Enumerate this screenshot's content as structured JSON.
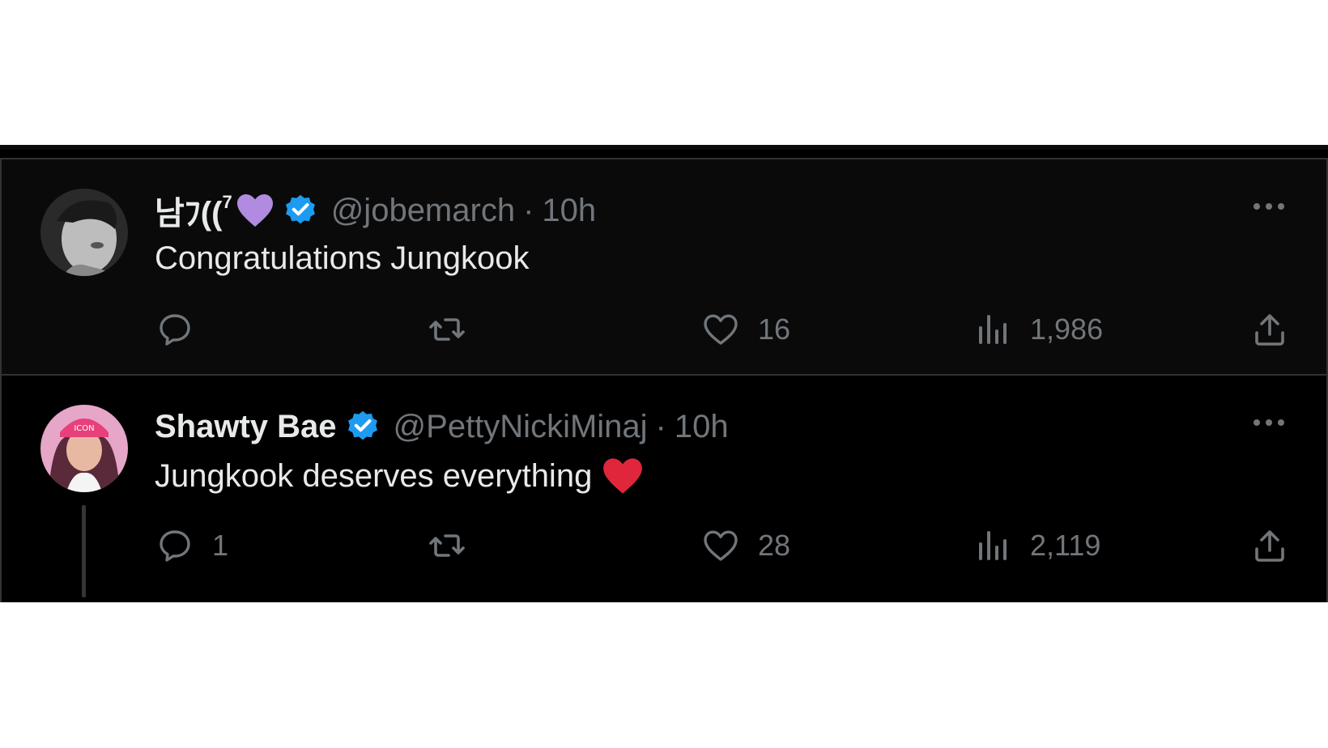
{
  "tweets": [
    {
      "name": "남ﾌ((",
      "name_suffix": "7",
      "name_emoji": "purple-heart",
      "handle": "@jobemarch",
      "separator": "·",
      "time": "10h",
      "text": "Congratulations Jungkook",
      "text_emoji": "",
      "replies": "",
      "retweets": "",
      "likes": "16",
      "views": "1,986"
    },
    {
      "name": "Shawty Bae",
      "handle": "@PettyNickiMinaj",
      "separator": "·",
      "time": "10h",
      "text": "Jungkook deserves everything",
      "text_emoji": "red-heart",
      "replies": "1",
      "retweets": "",
      "likes": "28",
      "views": "2,119"
    }
  ],
  "colors": {
    "background": "#000000",
    "text_primary": "#e7e9ea",
    "text_secondary": "#71767b",
    "verified_blue": "#1d9bf0",
    "purple_heart": "#b18be0",
    "red_heart": "#e0263b"
  }
}
